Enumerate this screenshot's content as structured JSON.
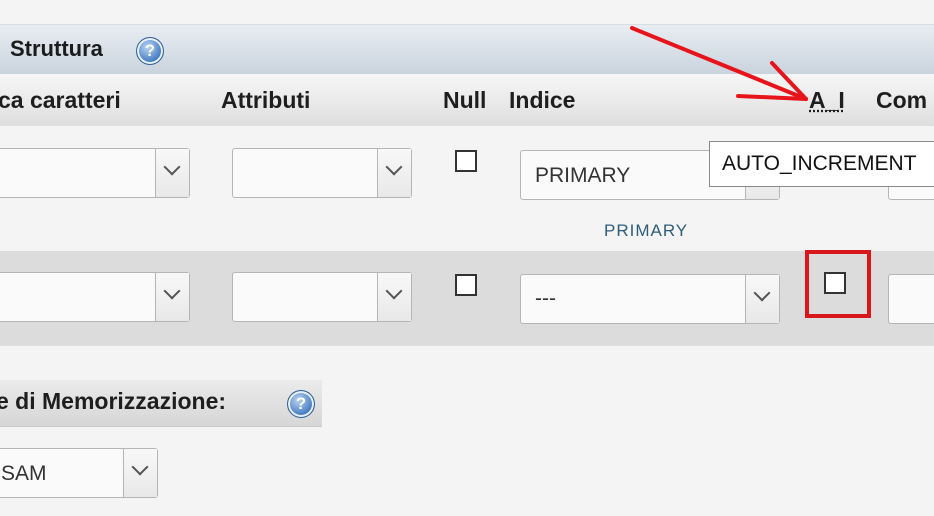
{
  "structure": {
    "title": "Struttura",
    "help_glyph": "?"
  },
  "columns": {
    "charset": "ca caratteri",
    "attributes": "Attributi",
    "null": "Null",
    "index": "Indice",
    "auto_increment": "A_I",
    "comment": "Com"
  },
  "row1": {
    "index_value": "PRIMARY",
    "index_name": "PRIMARY",
    "null_checked": false
  },
  "row2": {
    "index_value": "---",
    "null_checked": false,
    "ai_checked": false
  },
  "tooltip": {
    "text": "AUTO_INCREMENT"
  },
  "storage": {
    "label": "e di Memorizzazione:",
    "help_glyph": "?",
    "engine_value": "SAM"
  },
  "colors": {
    "annotation_arrow": "#e8141b",
    "highlight_box": "#d9161b",
    "index_name": "#2e5d7c"
  }
}
